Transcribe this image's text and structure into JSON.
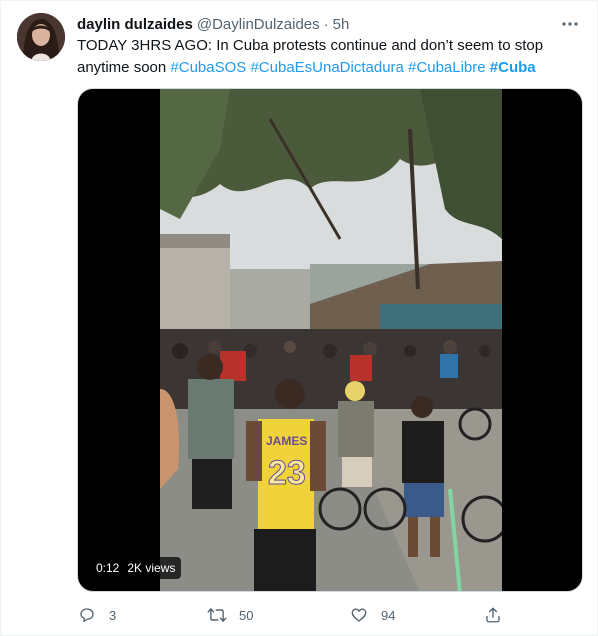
{
  "tweet": {
    "author": {
      "display_name": "daylin dulzaides",
      "handle": "@DaylinDulzaides",
      "time": "5h"
    },
    "text_plain": "TODAY 3HRS AGO: In Cuba protests continue and don’t seem to stop anytime soon ",
    "hashtags": [
      "#CubaSOS",
      "#CubaEsUnaDictadura",
      "#CubaLibre",
      "#Cuba"
    ],
    "media": {
      "elapsed": "0:12",
      "views": "2K views",
      "jersey_text": "JAMES"
    },
    "actions": {
      "reply_count": "3",
      "retweet_count": "50",
      "like_count": "94"
    }
  },
  "icons": {
    "more": "more-horizontal-icon",
    "reply": "reply-icon",
    "retweet": "retweet-icon",
    "like": "heart-icon",
    "share": "share-icon"
  },
  "colors": {
    "link": "#1d9bf0",
    "secondary_text": "#536471",
    "primary_text": "#0f1419"
  }
}
